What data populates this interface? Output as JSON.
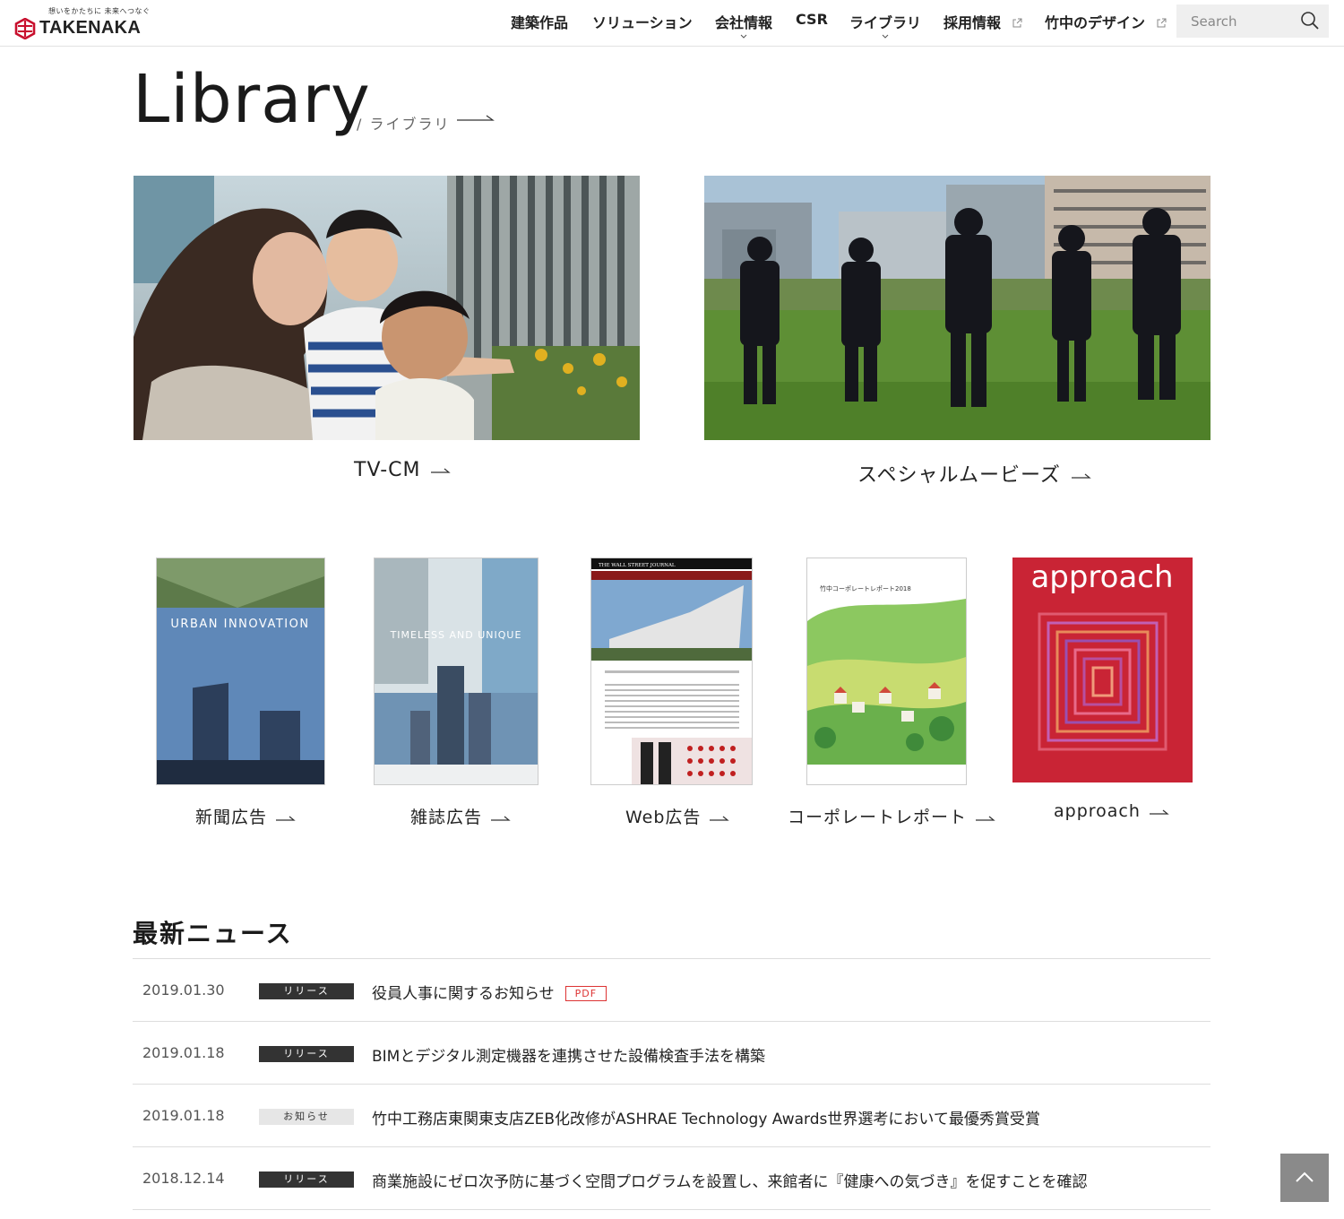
{
  "header": {
    "tagline": "想いをかたちに 未来へつなぐ",
    "brand": "TAKENAKA",
    "nav": [
      {
        "label": "建築作品"
      },
      {
        "label": "ソリューション"
      },
      {
        "label": "会社情報"
      },
      {
        "label": "CSR"
      },
      {
        "label": "ライブラリ"
      },
      {
        "label": "採用情報"
      },
      {
        "label": "竹中のデザイン"
      }
    ],
    "search_placeholder": "Search"
  },
  "library": {
    "title": "Library",
    "subtitle": "/ ライブラリ"
  },
  "features": [
    {
      "label": "TV-CM"
    },
    {
      "label": "スペシャルムービーズ"
    }
  ],
  "publications": [
    {
      "label": "新聞広告",
      "cover_text": "URBAN INNOVATION"
    },
    {
      "label": "雑誌広告",
      "cover_text": "TIMELESS AND UNIQUE"
    },
    {
      "label": "Web広告",
      "cover_text": "THE WALL STREET JOURNAL"
    },
    {
      "label": "コーポレートレポート",
      "cover_text": "竹中コーポレートレポート2018"
    },
    {
      "label": "approach",
      "cover_text": "approach"
    }
  ],
  "news": {
    "title": "最新ニュース",
    "items": [
      {
        "date": "2019.01.30",
        "tag": "リリース",
        "text": "役員人事に関するお知らせ",
        "pdf": "PDF"
      },
      {
        "date": "2019.01.18",
        "tag": "リリース",
        "text": "BIMとデジタル測定機器を連携させた設備検査手法を構築"
      },
      {
        "date": "2019.01.18",
        "tag": "お知らせ",
        "text": "竹中工務店東関東支店ZEB化改修がASHRAE Technology Awards世界選考において最優秀賞受賞"
      },
      {
        "date": "2018.12.14",
        "tag": "リリース",
        "text": "商業施設にゼロ次予防に基づく空間プログラムを設置し、来館者に『健康への気づき』を促すことを確認"
      }
    ]
  },
  "colors": {
    "brand_red": "#c8102e",
    "release_tag": "#333333",
    "notice_tag": "#e6e6e6",
    "pdf": "#dd3333"
  }
}
